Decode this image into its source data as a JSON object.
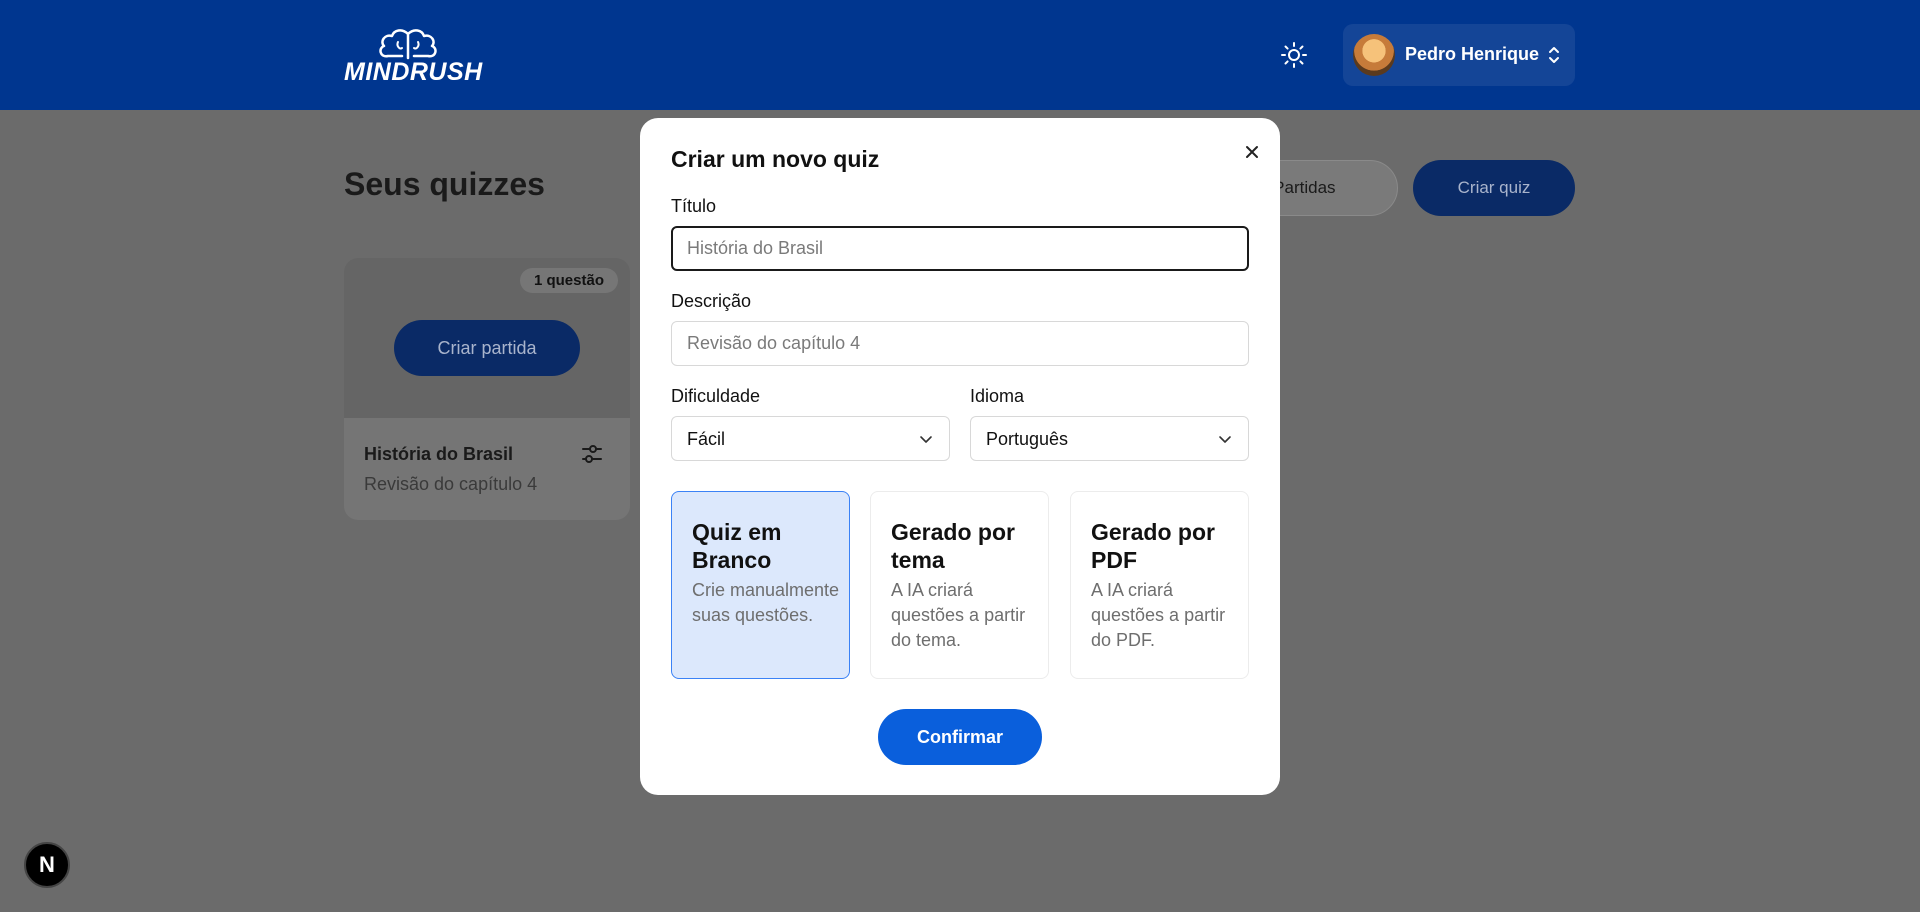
{
  "header": {
    "logo_text": "MINDRUSH",
    "user_name": "Pedro Henrique"
  },
  "page": {
    "title": "Seus quizzes",
    "partidas_button": "e Partidas",
    "criar_quiz_button": "Criar quiz"
  },
  "quiz_card": {
    "badge": "1 questão",
    "criar_partida_button": "Criar partida",
    "title": "História do Brasil",
    "description": "Revisão do capítulo 4"
  },
  "next_badge": "N",
  "modal": {
    "title": "Criar um novo quiz",
    "titulo_label": "Título",
    "titulo_placeholder": "História do Brasil",
    "descricao_label": "Descrição",
    "descricao_placeholder": "Revisão do capítulo 4",
    "dificuldade_label": "Dificuldade",
    "dificuldade_value": "Fácil",
    "idioma_label": "Idioma",
    "idioma_value": "Português",
    "options": [
      {
        "title": "Quiz em Branco",
        "description": "Crie manualmente suas questões.",
        "selected": true
      },
      {
        "title": "Gerado por tema",
        "description": "A IA criará questões a partir do tema.",
        "selected": false
      },
      {
        "title": "Gerado por PDF",
        "description": "A IA criará questões a partir do PDF.",
        "selected": false
      }
    ],
    "confirm_button": "Confirmar"
  },
  "colors": {
    "header_bg": "#00368f",
    "primary": "#0a5fdc",
    "selected_card_bg": "#dce8fc",
    "overlay": "#6b6b6b"
  }
}
